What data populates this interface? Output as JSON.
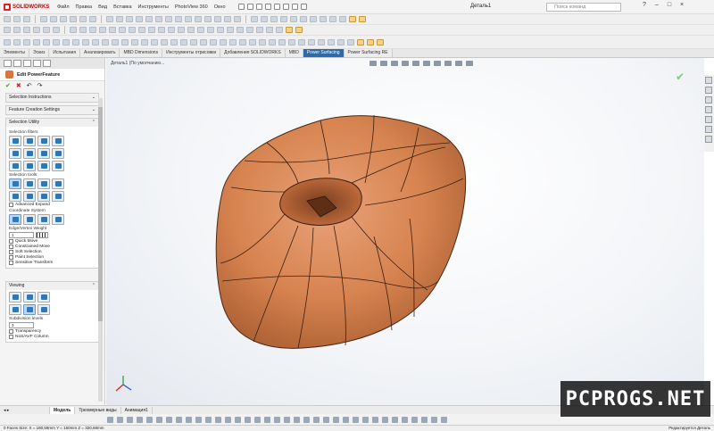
{
  "app": {
    "name": "SOLIDWORKS",
    "doc_title": "Деталь1"
  },
  "menu": [
    "Файл",
    "Правка",
    "Вид",
    "Вставка",
    "Инструменты",
    "PhotoView 360",
    "Окно"
  ],
  "search": {
    "placeholder": "Поиск команд"
  },
  "ribbon_tabs": [
    {
      "label": "Элементы",
      "active": false
    },
    {
      "label": "Эскиз",
      "active": false
    },
    {
      "label": "Испытания",
      "active": false
    },
    {
      "label": "Анализировать",
      "active": false
    },
    {
      "label": "MBD Dimensions",
      "active": false
    },
    {
      "label": "Инструменты отрисовки",
      "active": false
    },
    {
      "label": "Добавления SOLIDWORKS",
      "active": false
    },
    {
      "label": "MBD",
      "active": false
    },
    {
      "label": "Power Surfacing",
      "active": true
    },
    {
      "label": "Power Surfacing RE",
      "active": false
    }
  ],
  "breadcrumb": "Деталь1 (По умолчанию...",
  "panel": {
    "title": "Edit PowerFeature",
    "sections": {
      "selection_instructions": "Selection Instructions",
      "feature_creation": "Feature Creation Settings",
      "selection_utility": "Selection Utility",
      "selection_filters": "Selection filters",
      "selection_tools": "Selection tools",
      "advanced_expand": "Advanced Expand",
      "coordinate_system": "Coordinate System",
      "edge_weight": "Edge/Vertex Weight",
      "edge_weight_value": "1",
      "quick_move": "Quick Move",
      "constrained_move": "Constrained Move",
      "soft_selection": "Soft Selection",
      "paint_selection": "Paint Selection",
      "sensitive_transform": "Sensitive Transform",
      "viewing": "Viewing",
      "subdivision_levels": "Subdivision levels",
      "subdivision_value": "3",
      "transparency": "Transparency",
      "nos_column": "NoS/AVF Column"
    }
  },
  "bottom_tabs": [
    {
      "label": "Модель",
      "active": true
    },
    {
      "label": "Трехмерные виды",
      "active": false
    },
    {
      "label": "Анимация1",
      "active": false
    }
  ],
  "status": {
    "left": "0 Faces Size: X = 180,59mm Y = 150mm Z = 320,68mm",
    "right": "Редактируется Деталь"
  },
  "watermark": "PCPROGS.NET",
  "colors": {
    "model": "#d9895a",
    "accent": "#2f6aa8"
  }
}
